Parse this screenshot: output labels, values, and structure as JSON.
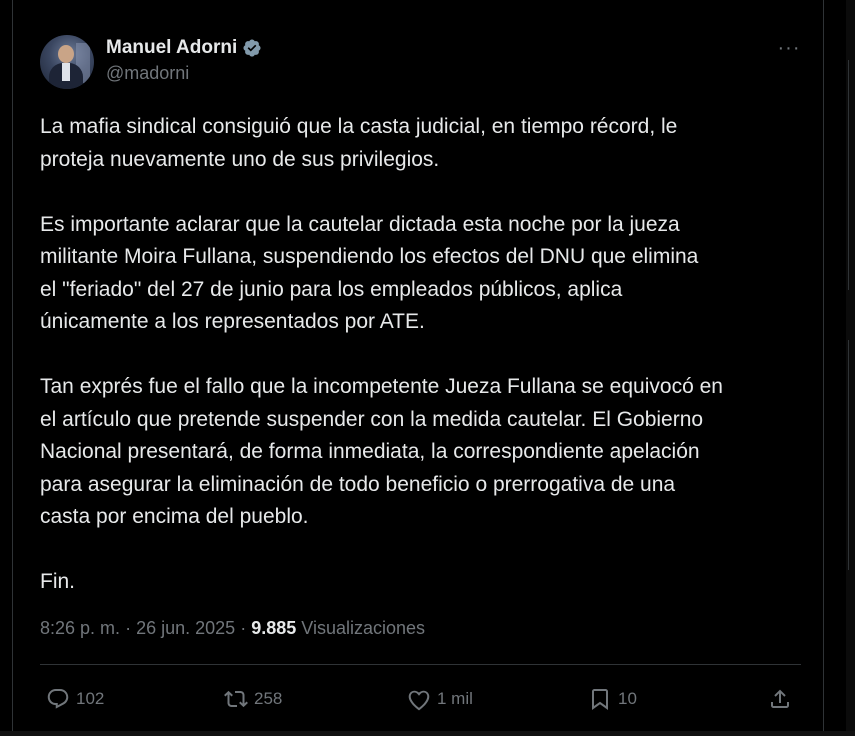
{
  "author": {
    "display_name": "Manuel Adorni",
    "handle": "@madorni",
    "verified": true
  },
  "more_icon": "more-horizontal-icon",
  "tweet": {
    "paragraphs": [
      "La mafia sindical consiguió que la casta judicial, en tiempo récord, le\nproteja nuevamente uno de sus privilegios.",
      "Es importante aclarar que la cautelar dictada esta noche por la jueza\nmilitante Moira Fullana, suspendiendo los efectos del DNU que elimina\nel \"feriado\" del 27 de junio para los empleados públicos, aplica\núnicamente a los representados por ATE.",
      "Tan exprés fue el fallo que la incompetente Jueza Fullana se equivocó en\nel artículo que pretende suspender con la medida cautelar. El Gobierno\nNacional presentará, de forma inmediata, la correspondiente apelación\npara asegurar la eliminación de todo beneficio o prerrogativa de una\ncasta por encima del pueblo.",
      "Fin."
    ]
  },
  "meta": {
    "time": "8:26 p. m.",
    "separator": "·",
    "date": "26 jun. 2025",
    "views_count": "9.885",
    "views_label": "Visualizaciones"
  },
  "actions": {
    "replies": "102",
    "reposts": "258",
    "likes": "1 mil",
    "bookmarks": "10"
  },
  "colors": {
    "background": "#000000",
    "text": "#e7e9ea",
    "muted": "#71767b",
    "border": "#2f3336",
    "verified": "#829aab"
  }
}
